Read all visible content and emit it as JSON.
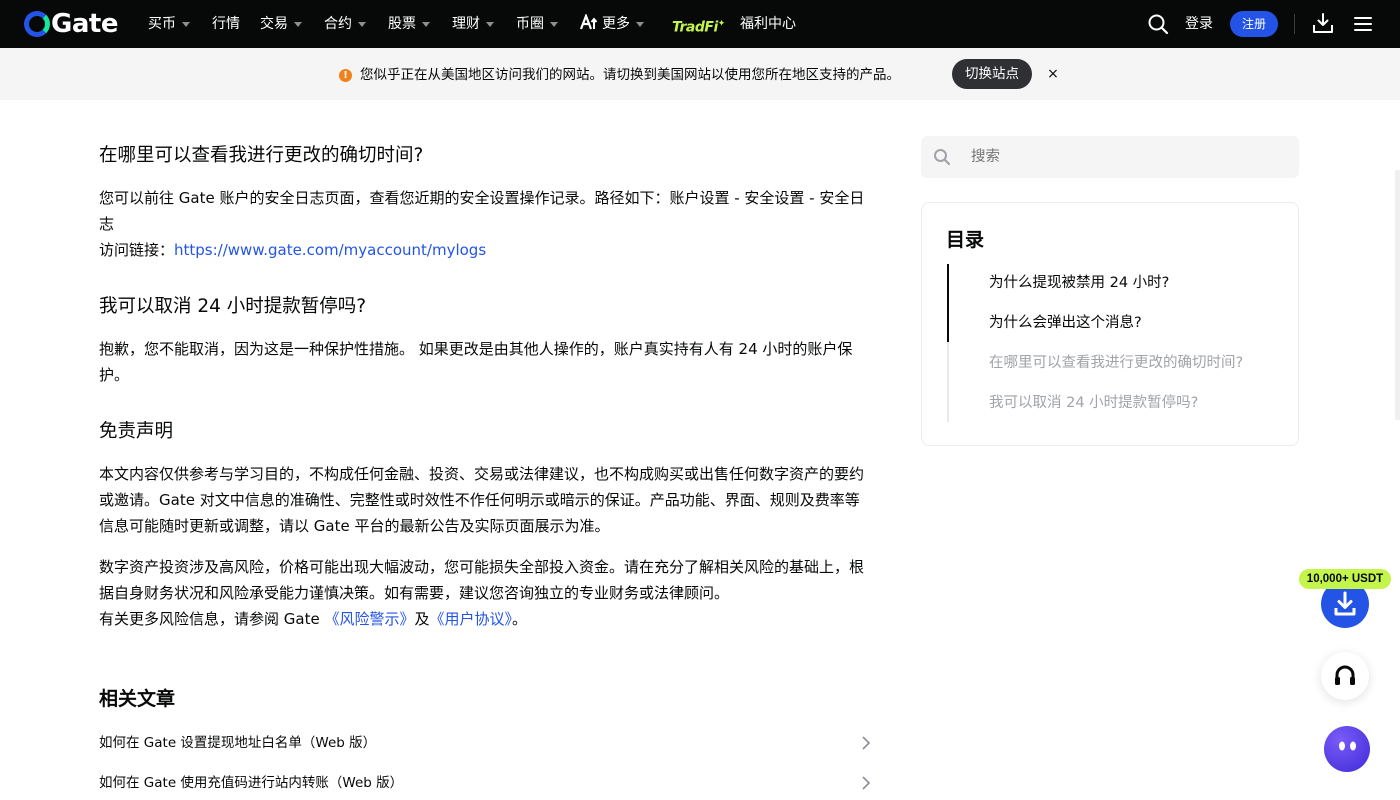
{
  "nav": {
    "logo_text": "Gate",
    "items": [
      {
        "label": "买币",
        "has_caret": true
      },
      {
        "label": "行情",
        "has_caret": false
      },
      {
        "label": "交易",
        "has_caret": true
      },
      {
        "label": "合约",
        "has_caret": true
      },
      {
        "label": "股票",
        "has_caret": true
      },
      {
        "label": "理财",
        "has_caret": true
      },
      {
        "label": "币圈",
        "has_caret": true
      },
      {
        "label": "更多",
        "has_caret": true
      }
    ],
    "tradfi_label": "TradFi",
    "welfare_label": "福利中心",
    "login_label": "登录",
    "signup_label": "注册",
    "icons": [
      "search-icon",
      "download-icon",
      "menu-icon"
    ],
    "accent_color": "#2354e6"
  },
  "banner": {
    "message": "您似乎正在从美国地区访问我们的网站。请切换到美国网站以使用您所在地区支持的产品。",
    "switch_label": "切换站点",
    "close_label": "×",
    "warning_color": "#f0821b"
  },
  "article": {
    "sections": [
      {
        "heading": "在哪里可以查看我进行更改的确切时间?",
        "body": "您可以前往 Gate 账户的安全日志页面，查看您近期的安全设置操作记录。路径如下：账户设置 - 安全设置 - 安全日志",
        "link_prefix": "访问链接：",
        "link_text": "https://www.gate.com/myaccount/mylogs"
      },
      {
        "heading": "我可以取消 24 小时提款暂停吗?",
        "body": "抱歉，您不能取消，因为这是一种保护性措施。 如果更改是由其他人操作的，账户真实持有人有 24 小时的账户保护。"
      },
      {
        "heading": "免责声明",
        "body": "本文内容仅供参考与学习目的，不构成任何金融、投资、交易或法律建议，也不构成购买或出售任何数字资产的要约或邀请。Gate 对文中信息的准确性、完整性或时效性不作任何明示或暗示的保证。产品功能、界面、规则及费率等信息可能随时更新或调整，请以 Gate 平台的最新公告及实际页面展示为准。",
        "body2": "数字资产投资涉及高风险，价格可能出现大幅波动，您可能损失全部投入资金。请在充分了解相关风险的基础上，根据自身财务状况和风险承受能力谨慎决策。如有需要，建议您咨询独立的专业财务或法律顾问。",
        "risk_prefix": "有关更多风险信息，请参阅 Gate ",
        "risk_link": "《风险警示》",
        "risk_and": "及",
        "agreement_link": "《用户协议》",
        "risk_suffix": "。"
      }
    ],
    "related_title": "相关文章",
    "related": [
      "如何在 Gate 设置提现地址白名单（Web 版）",
      "如何在 Gate 使用充值码进行站内转账（Web 版）"
    ]
  },
  "sidebar": {
    "search_placeholder": "搜索",
    "toc_title": "目录",
    "toc_items": [
      {
        "label": "为什么提现被禁用 24 小时?",
        "active": true
      },
      {
        "label": "为什么会弹出这个消息?",
        "active": true
      },
      {
        "label": "在哪里可以查看我进行更改的确切时间?",
        "active": false
      },
      {
        "label": "我可以取消 24 小时提款暂停吗?",
        "active": false
      }
    ]
  },
  "floating": {
    "promo_badge": "10,000+ USDT",
    "icons": [
      "download-icon",
      "headset-icon",
      "chatbot-icon"
    ]
  }
}
